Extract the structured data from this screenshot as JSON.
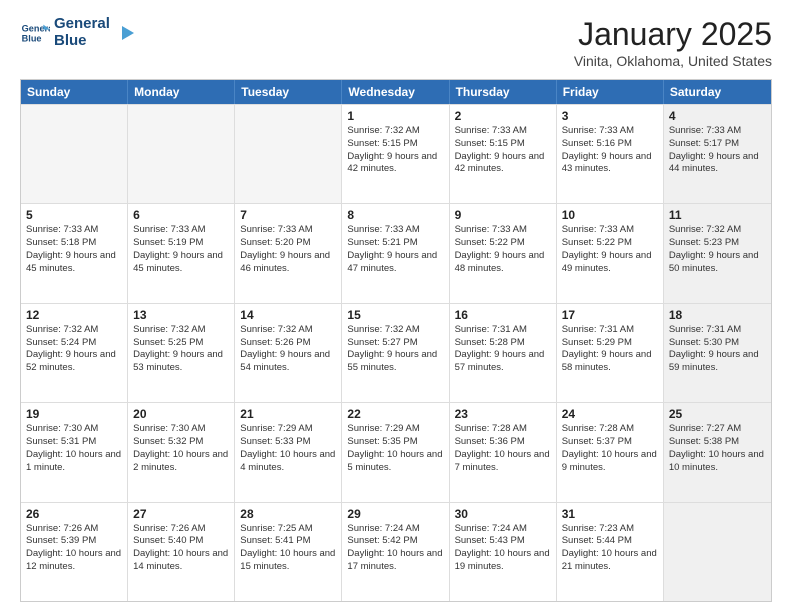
{
  "header": {
    "logo_line1": "General",
    "logo_line2": "Blue",
    "month": "January 2025",
    "location": "Vinita, Oklahoma, United States"
  },
  "days_of_week": [
    "Sunday",
    "Monday",
    "Tuesday",
    "Wednesday",
    "Thursday",
    "Friday",
    "Saturday"
  ],
  "weeks": [
    [
      {
        "day": "",
        "text": "",
        "empty": true
      },
      {
        "day": "",
        "text": "",
        "empty": true
      },
      {
        "day": "",
        "text": "",
        "empty": true
      },
      {
        "day": "1",
        "text": "Sunrise: 7:32 AM\nSunset: 5:15 PM\nDaylight: 9 hours and 42 minutes."
      },
      {
        "day": "2",
        "text": "Sunrise: 7:33 AM\nSunset: 5:15 PM\nDaylight: 9 hours and 42 minutes."
      },
      {
        "day": "3",
        "text": "Sunrise: 7:33 AM\nSunset: 5:16 PM\nDaylight: 9 hours and 43 minutes."
      },
      {
        "day": "4",
        "text": "Sunrise: 7:33 AM\nSunset: 5:17 PM\nDaylight: 9 hours and 44 minutes.",
        "shaded": true
      }
    ],
    [
      {
        "day": "5",
        "text": "Sunrise: 7:33 AM\nSunset: 5:18 PM\nDaylight: 9 hours and 45 minutes."
      },
      {
        "day": "6",
        "text": "Sunrise: 7:33 AM\nSunset: 5:19 PM\nDaylight: 9 hours and 45 minutes."
      },
      {
        "day": "7",
        "text": "Sunrise: 7:33 AM\nSunset: 5:20 PM\nDaylight: 9 hours and 46 minutes."
      },
      {
        "day": "8",
        "text": "Sunrise: 7:33 AM\nSunset: 5:21 PM\nDaylight: 9 hours and 47 minutes."
      },
      {
        "day": "9",
        "text": "Sunrise: 7:33 AM\nSunset: 5:22 PM\nDaylight: 9 hours and 48 minutes."
      },
      {
        "day": "10",
        "text": "Sunrise: 7:33 AM\nSunset: 5:22 PM\nDaylight: 9 hours and 49 minutes."
      },
      {
        "day": "11",
        "text": "Sunrise: 7:32 AM\nSunset: 5:23 PM\nDaylight: 9 hours and 50 minutes.",
        "shaded": true
      }
    ],
    [
      {
        "day": "12",
        "text": "Sunrise: 7:32 AM\nSunset: 5:24 PM\nDaylight: 9 hours and 52 minutes."
      },
      {
        "day": "13",
        "text": "Sunrise: 7:32 AM\nSunset: 5:25 PM\nDaylight: 9 hours and 53 minutes."
      },
      {
        "day": "14",
        "text": "Sunrise: 7:32 AM\nSunset: 5:26 PM\nDaylight: 9 hours and 54 minutes."
      },
      {
        "day": "15",
        "text": "Sunrise: 7:32 AM\nSunset: 5:27 PM\nDaylight: 9 hours and 55 minutes."
      },
      {
        "day": "16",
        "text": "Sunrise: 7:31 AM\nSunset: 5:28 PM\nDaylight: 9 hours and 57 minutes."
      },
      {
        "day": "17",
        "text": "Sunrise: 7:31 AM\nSunset: 5:29 PM\nDaylight: 9 hours and 58 minutes."
      },
      {
        "day": "18",
        "text": "Sunrise: 7:31 AM\nSunset: 5:30 PM\nDaylight: 9 hours and 59 minutes.",
        "shaded": true
      }
    ],
    [
      {
        "day": "19",
        "text": "Sunrise: 7:30 AM\nSunset: 5:31 PM\nDaylight: 10 hours and 1 minute."
      },
      {
        "day": "20",
        "text": "Sunrise: 7:30 AM\nSunset: 5:32 PM\nDaylight: 10 hours and 2 minutes."
      },
      {
        "day": "21",
        "text": "Sunrise: 7:29 AM\nSunset: 5:33 PM\nDaylight: 10 hours and 4 minutes."
      },
      {
        "day": "22",
        "text": "Sunrise: 7:29 AM\nSunset: 5:35 PM\nDaylight: 10 hours and 5 minutes."
      },
      {
        "day": "23",
        "text": "Sunrise: 7:28 AM\nSunset: 5:36 PM\nDaylight: 10 hours and 7 minutes."
      },
      {
        "day": "24",
        "text": "Sunrise: 7:28 AM\nSunset: 5:37 PM\nDaylight: 10 hours and 9 minutes."
      },
      {
        "day": "25",
        "text": "Sunrise: 7:27 AM\nSunset: 5:38 PM\nDaylight: 10 hours and 10 minutes.",
        "shaded": true
      }
    ],
    [
      {
        "day": "26",
        "text": "Sunrise: 7:26 AM\nSunset: 5:39 PM\nDaylight: 10 hours and 12 minutes."
      },
      {
        "day": "27",
        "text": "Sunrise: 7:26 AM\nSunset: 5:40 PM\nDaylight: 10 hours and 14 minutes."
      },
      {
        "day": "28",
        "text": "Sunrise: 7:25 AM\nSunset: 5:41 PM\nDaylight: 10 hours and 15 minutes."
      },
      {
        "day": "29",
        "text": "Sunrise: 7:24 AM\nSunset: 5:42 PM\nDaylight: 10 hours and 17 minutes."
      },
      {
        "day": "30",
        "text": "Sunrise: 7:24 AM\nSunset: 5:43 PM\nDaylight: 10 hours and 19 minutes."
      },
      {
        "day": "31",
        "text": "Sunrise: 7:23 AM\nSunset: 5:44 PM\nDaylight: 10 hours and 21 minutes."
      },
      {
        "day": "",
        "text": "",
        "empty": true,
        "shaded": true
      }
    ]
  ]
}
